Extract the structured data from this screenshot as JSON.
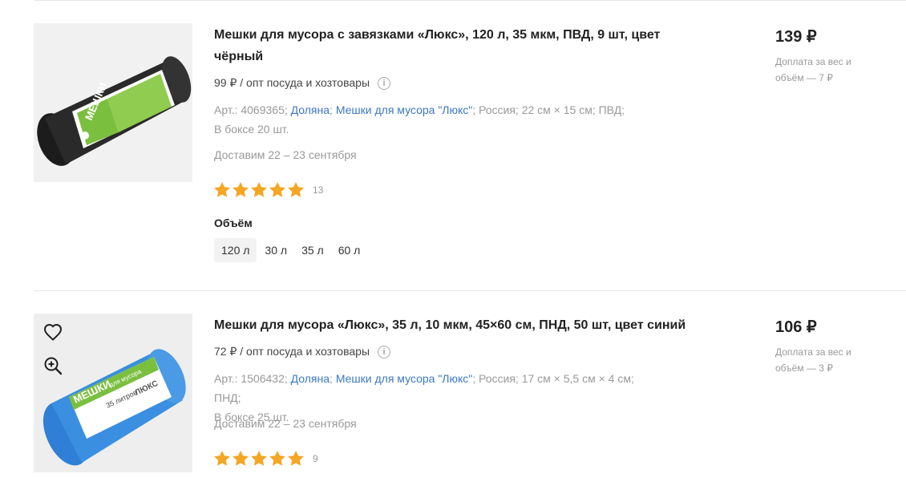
{
  "products": [
    {
      "title": "Мешки для мусора с завязками «Люкс», 120 л, 35 мкм, ПВД, 9 шт, цвет чёрный",
      "price": "139 ₽",
      "surcharge": "Доплата за вес и объём — 7 ₽",
      "wholesale": "99 ₽ / опт посуда и хозтовары",
      "article_prefix": "Арт.: 4069365;",
      "brand": "Доляна",
      "series": "Мешки для мусора \"Люкс\"",
      "spec_rest": "; Россия; 22 см × 15 см; ПВД;",
      "box": "В боксе 20 шт.",
      "delivery": "Доставим 22 – 23 сентября",
      "rating": 5,
      "review_count": "13",
      "volume_label": "Объём",
      "volume_options": [
        "120 л",
        "30 л",
        "35 л",
        "60 л"
      ],
      "volume_selected": "120 л",
      "image_label": "МЕШКИ",
      "image_sub": "для мусора",
      "bag_color": "#2a2a2a"
    },
    {
      "title": "Мешки для мусора «Люкс», 35 л, 10 мкм, 45×60 см, ПНД, 50 шт, цвет синий",
      "price": "106 ₽",
      "surcharge": "Доплата за вес и объём — 3 ₽",
      "wholesale": "72 ₽ / опт посуда и хозтовары",
      "article_prefix": "Арт.: 1506432;",
      "brand": "Доляна",
      "series": "Мешки для мусора \"Люкс\"",
      "spec_rest": "; Россия; 17 см × 5,5 см × 4 см; ПНД;",
      "box": "В боксе 25 шт.",
      "delivery": "Доставим 22 – 23 сентября",
      "rating": 5,
      "review_count": "9",
      "image_label": "МЕШКИ",
      "image_sub": "для мусора",
      "image_badge": "35 литров",
      "image_brand": "ЛЮКС",
      "bag_color": "#3a8fe0"
    }
  ],
  "colors": {
    "star": "#f5a623",
    "link": "#3c78c3",
    "muted": "#999999",
    "label_green": "#7bbf3f"
  }
}
